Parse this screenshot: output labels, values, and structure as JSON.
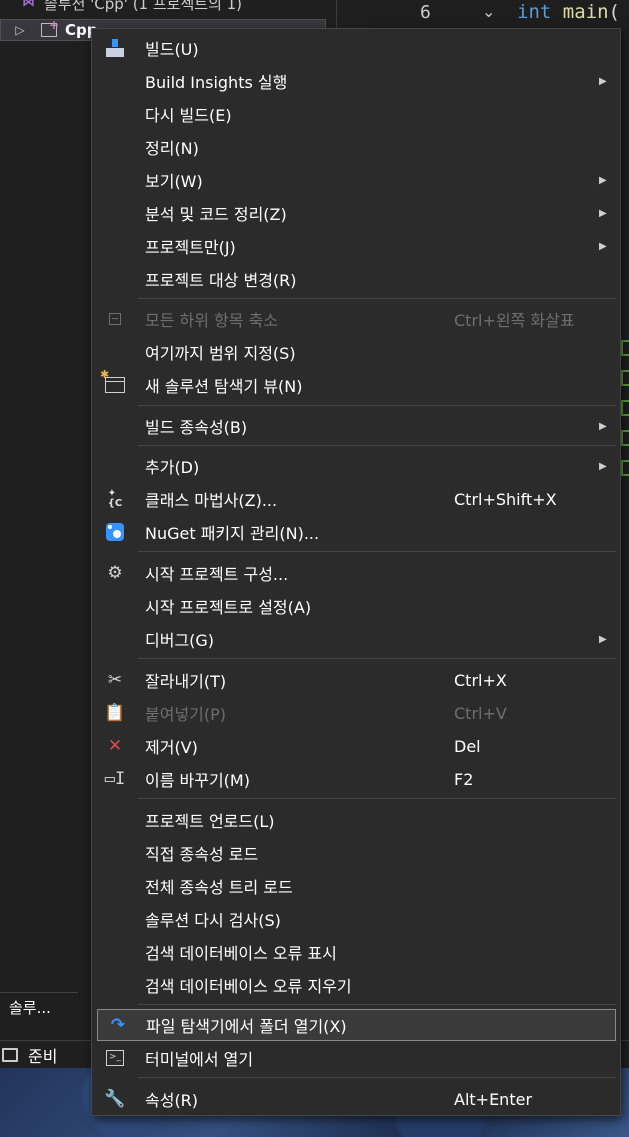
{
  "explorer": {
    "solution_label": "솔루션 'Cpp' (1 프로젝트의 1)",
    "project_label": "Cpp",
    "tab_label": "솔루..."
  },
  "editor": {
    "line_number": "6",
    "code_keyword": "int",
    "code_function": "main",
    "code_punct": "("
  },
  "status": {
    "text": "준비"
  },
  "menu": {
    "items": [
      {
        "label": "빌드(U)",
        "icon": "build-icon"
      },
      {
        "label": "Build Insights 실행",
        "submenu": true
      },
      {
        "label": "다시 빌드(E)"
      },
      {
        "label": "정리(N)"
      },
      {
        "label": "보기(W)",
        "submenu": true
      },
      {
        "label": "분석 및 코드 정리(Z)",
        "submenu": true
      },
      {
        "label": "프로젝트만(J)",
        "submenu": true
      },
      {
        "label": "프로젝트 대상 변경(R)"
      },
      {
        "label": "모든 하위 항목 축소",
        "shortcut": "Ctrl+왼쪽 화살표",
        "disabled": true,
        "icon": "collapse-icon"
      },
      {
        "label": "여기까지 범위 지정(S)"
      },
      {
        "label": "새 솔루션 탐색기 뷰(N)",
        "icon": "new-view-icon"
      },
      {
        "label": "빌드 종속성(B)",
        "submenu": true
      },
      {
        "label": "추가(D)",
        "submenu": true
      },
      {
        "label": "클래스 마법사(Z)...",
        "shortcut": "Ctrl+Shift+X",
        "icon": "class-wizard-icon"
      },
      {
        "label": "NuGet 패키지 관리(N)...",
        "icon": "nuget-icon"
      },
      {
        "label": "시작 프로젝트 구성...",
        "icon": "gear-icon"
      },
      {
        "label": "시작 프로젝트로 설정(A)"
      },
      {
        "label": "디버그(G)",
        "submenu": true
      },
      {
        "label": "잘라내기(T)",
        "shortcut": "Ctrl+X",
        "icon": "cut-icon"
      },
      {
        "label": "붙여넣기(P)",
        "shortcut": "Ctrl+V",
        "disabled": true,
        "icon": "paste-icon"
      },
      {
        "label": "제거(V)",
        "shortcut": "Del",
        "icon": "delete-icon"
      },
      {
        "label": "이름 바꾸기(M)",
        "shortcut": "F2",
        "icon": "rename-icon"
      },
      {
        "label": "프로젝트 언로드(L)"
      },
      {
        "label": "직접 종속성 로드"
      },
      {
        "label": "전체 종속성 트리 로드"
      },
      {
        "label": "솔루션 다시 검사(S)"
      },
      {
        "label": "검색 데이터베이스 오류 표시"
      },
      {
        "label": "검색 데이터베이스 오류 지우기"
      },
      {
        "label": "파일 탐색기에서 폴더 열기(X)",
        "highlighted": true,
        "icon": "open-folder-icon"
      },
      {
        "label": "터미널에서 열기",
        "icon": "terminal-icon"
      },
      {
        "label": "속성(R)",
        "shortcut": "Alt+Enter",
        "icon": "wrench-icon"
      }
    ],
    "arrow_glyph": "▶",
    "colors": {
      "background": "#2b2b2b",
      "disabled_text": "#6e6e6e",
      "highlight_border": "#8a8a8a",
      "accent": "#3794ff",
      "delete": "#e04848"
    }
  }
}
